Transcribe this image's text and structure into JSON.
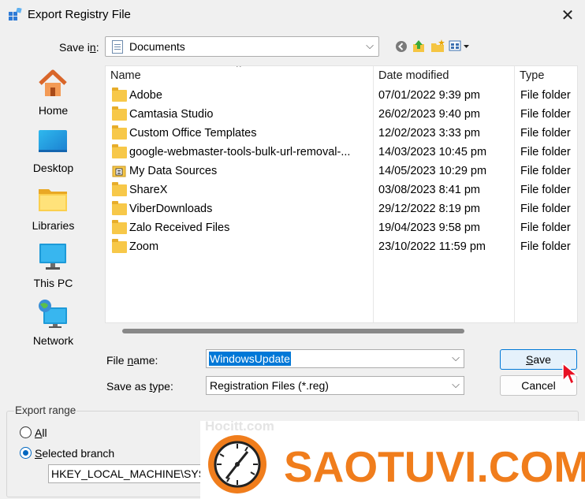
{
  "window": {
    "title": "Export Registry File",
    "close_glyph": "✕"
  },
  "save_in": {
    "label": "Save in:",
    "value": "Documents"
  },
  "places": [
    {
      "label": "Home",
      "icon": "home-icon"
    },
    {
      "label": "Desktop",
      "icon": "desktop-icon"
    },
    {
      "label": "Libraries",
      "icon": "libraries-icon"
    },
    {
      "label": "This PC",
      "icon": "this-pc-icon"
    },
    {
      "label": "Network",
      "icon": "network-icon"
    }
  ],
  "file_list": {
    "columns": {
      "name": "Name",
      "date": "Date modified",
      "type": "Type"
    },
    "rows": [
      {
        "name": "Adobe",
        "date": "07/01/2022 9:39 pm",
        "type": "File folder",
        "icon": "folder-icon"
      },
      {
        "name": "Camtasia Studio",
        "date": "26/02/2023 9:40 pm",
        "type": "File folder",
        "icon": "folder-icon"
      },
      {
        "name": "Custom Office Templates",
        "date": "12/02/2023 3:33 pm",
        "type": "File folder",
        "icon": "folder-icon"
      },
      {
        "name": "google-webmaster-tools-bulk-url-removal-...",
        "date": "14/03/2023 10:45 pm",
        "type": "File folder",
        "icon": "folder-icon"
      },
      {
        "name": "My Data Sources",
        "date": "14/05/2023 10:29 pm",
        "type": "File folder",
        "icon": "data-sources-folder-icon"
      },
      {
        "name": "ShareX",
        "date": "03/08/2023 8:41 pm",
        "type": "File folder",
        "icon": "folder-icon"
      },
      {
        "name": "ViberDownloads",
        "date": "29/12/2022 8:19 pm",
        "type": "File folder",
        "icon": "folder-icon"
      },
      {
        "name": "Zalo Received Files",
        "date": "19/04/2023 9:58 pm",
        "type": "File folder",
        "icon": "folder-icon"
      },
      {
        "name": "Zoom",
        "date": "23/10/2022 11:59 pm",
        "type": "File folder",
        "icon": "folder-icon"
      }
    ]
  },
  "file_name": {
    "label": "File name:",
    "value": "WindowsUpdate"
  },
  "save_as_type": {
    "label": "Save as type:",
    "value": "Registration Files (*.reg)"
  },
  "buttons": {
    "save": "Save",
    "cancel": "Cancel"
  },
  "export_range": {
    "label": "Export range",
    "all_label": "All",
    "branch_label": "Selected branch",
    "branch_value": "HKEY_LOCAL_MACHINE\\SYSTEM",
    "selected": "branch"
  },
  "watermark": {
    "text": "SAOTUVI.COM",
    "faint_text": "Hocitt.com",
    "color": "#f07d1c"
  },
  "colors": {
    "accent": "#0078d7",
    "folder": "#f7c849",
    "background": "#f0f0f0"
  }
}
